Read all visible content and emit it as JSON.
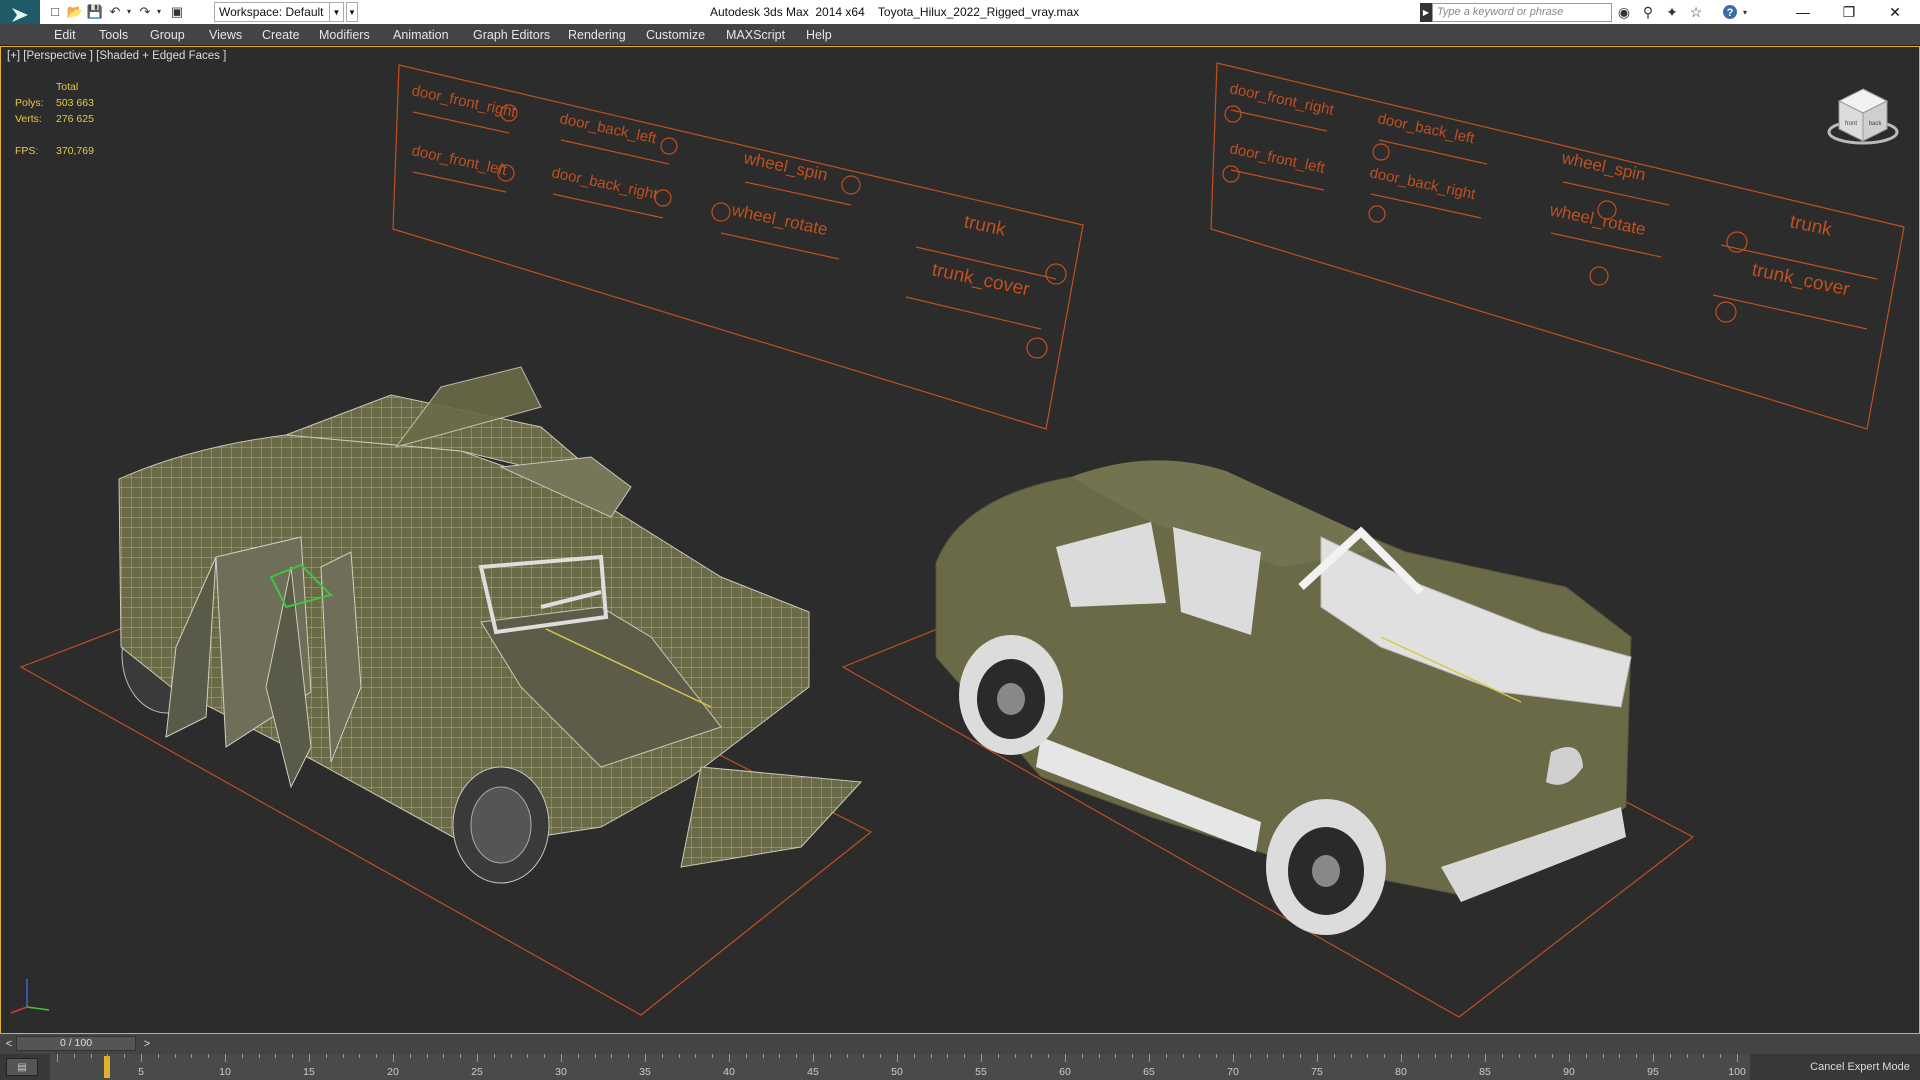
{
  "title_bar": {
    "workspace_label": "Workspace: Default",
    "app_title": "Autodesk 3ds Max  2014 x64",
    "file_name": "Toyota_Hilux_2022_Rigged_vray.max",
    "search_placeholder": "Type a keyword or phrase",
    "window_controls": [
      "minimize-icon",
      "restore-icon",
      "close-icon"
    ]
  },
  "menu": [
    "Edit",
    "Tools",
    "Group",
    "Views",
    "Create",
    "Modifiers",
    "Animation",
    "Graph Editors",
    "Rendering",
    "Customize",
    "MAXScript",
    "Help"
  ],
  "viewport": {
    "label": "[+] [Perspective ] [Shaded + Edged Faces ]",
    "stats": {
      "header": "Total",
      "polys_label": "Polys:",
      "polys_value": "503 663",
      "verts_label": "Verts:",
      "verts_value": "276 625",
      "fps_label": "FPS:",
      "fps_value": "370,769"
    },
    "rig_controls": [
      "door_front_right",
      "door_front_left",
      "door_back_left",
      "door_back_right",
      "wheel_spin",
      "wheel_rotate",
      "trunk",
      "trunk_cover"
    ],
    "viewcube": {
      "front": "front",
      "back": "back"
    },
    "accent_color": "#c0501e",
    "truck_color": "#6b6a46"
  },
  "timeline": {
    "frame_display": "0 / 100",
    "prev": "<",
    "next": ">",
    "ticks": [
      "0",
      "5",
      "10",
      "15",
      "20",
      "25",
      "30",
      "35",
      "40",
      "45",
      "50",
      "55",
      "60",
      "65",
      "70",
      "75",
      "80",
      "85",
      "90",
      "95",
      "100"
    ]
  },
  "status": {
    "cancel_expert_mode": "Cancel Expert Mode"
  }
}
